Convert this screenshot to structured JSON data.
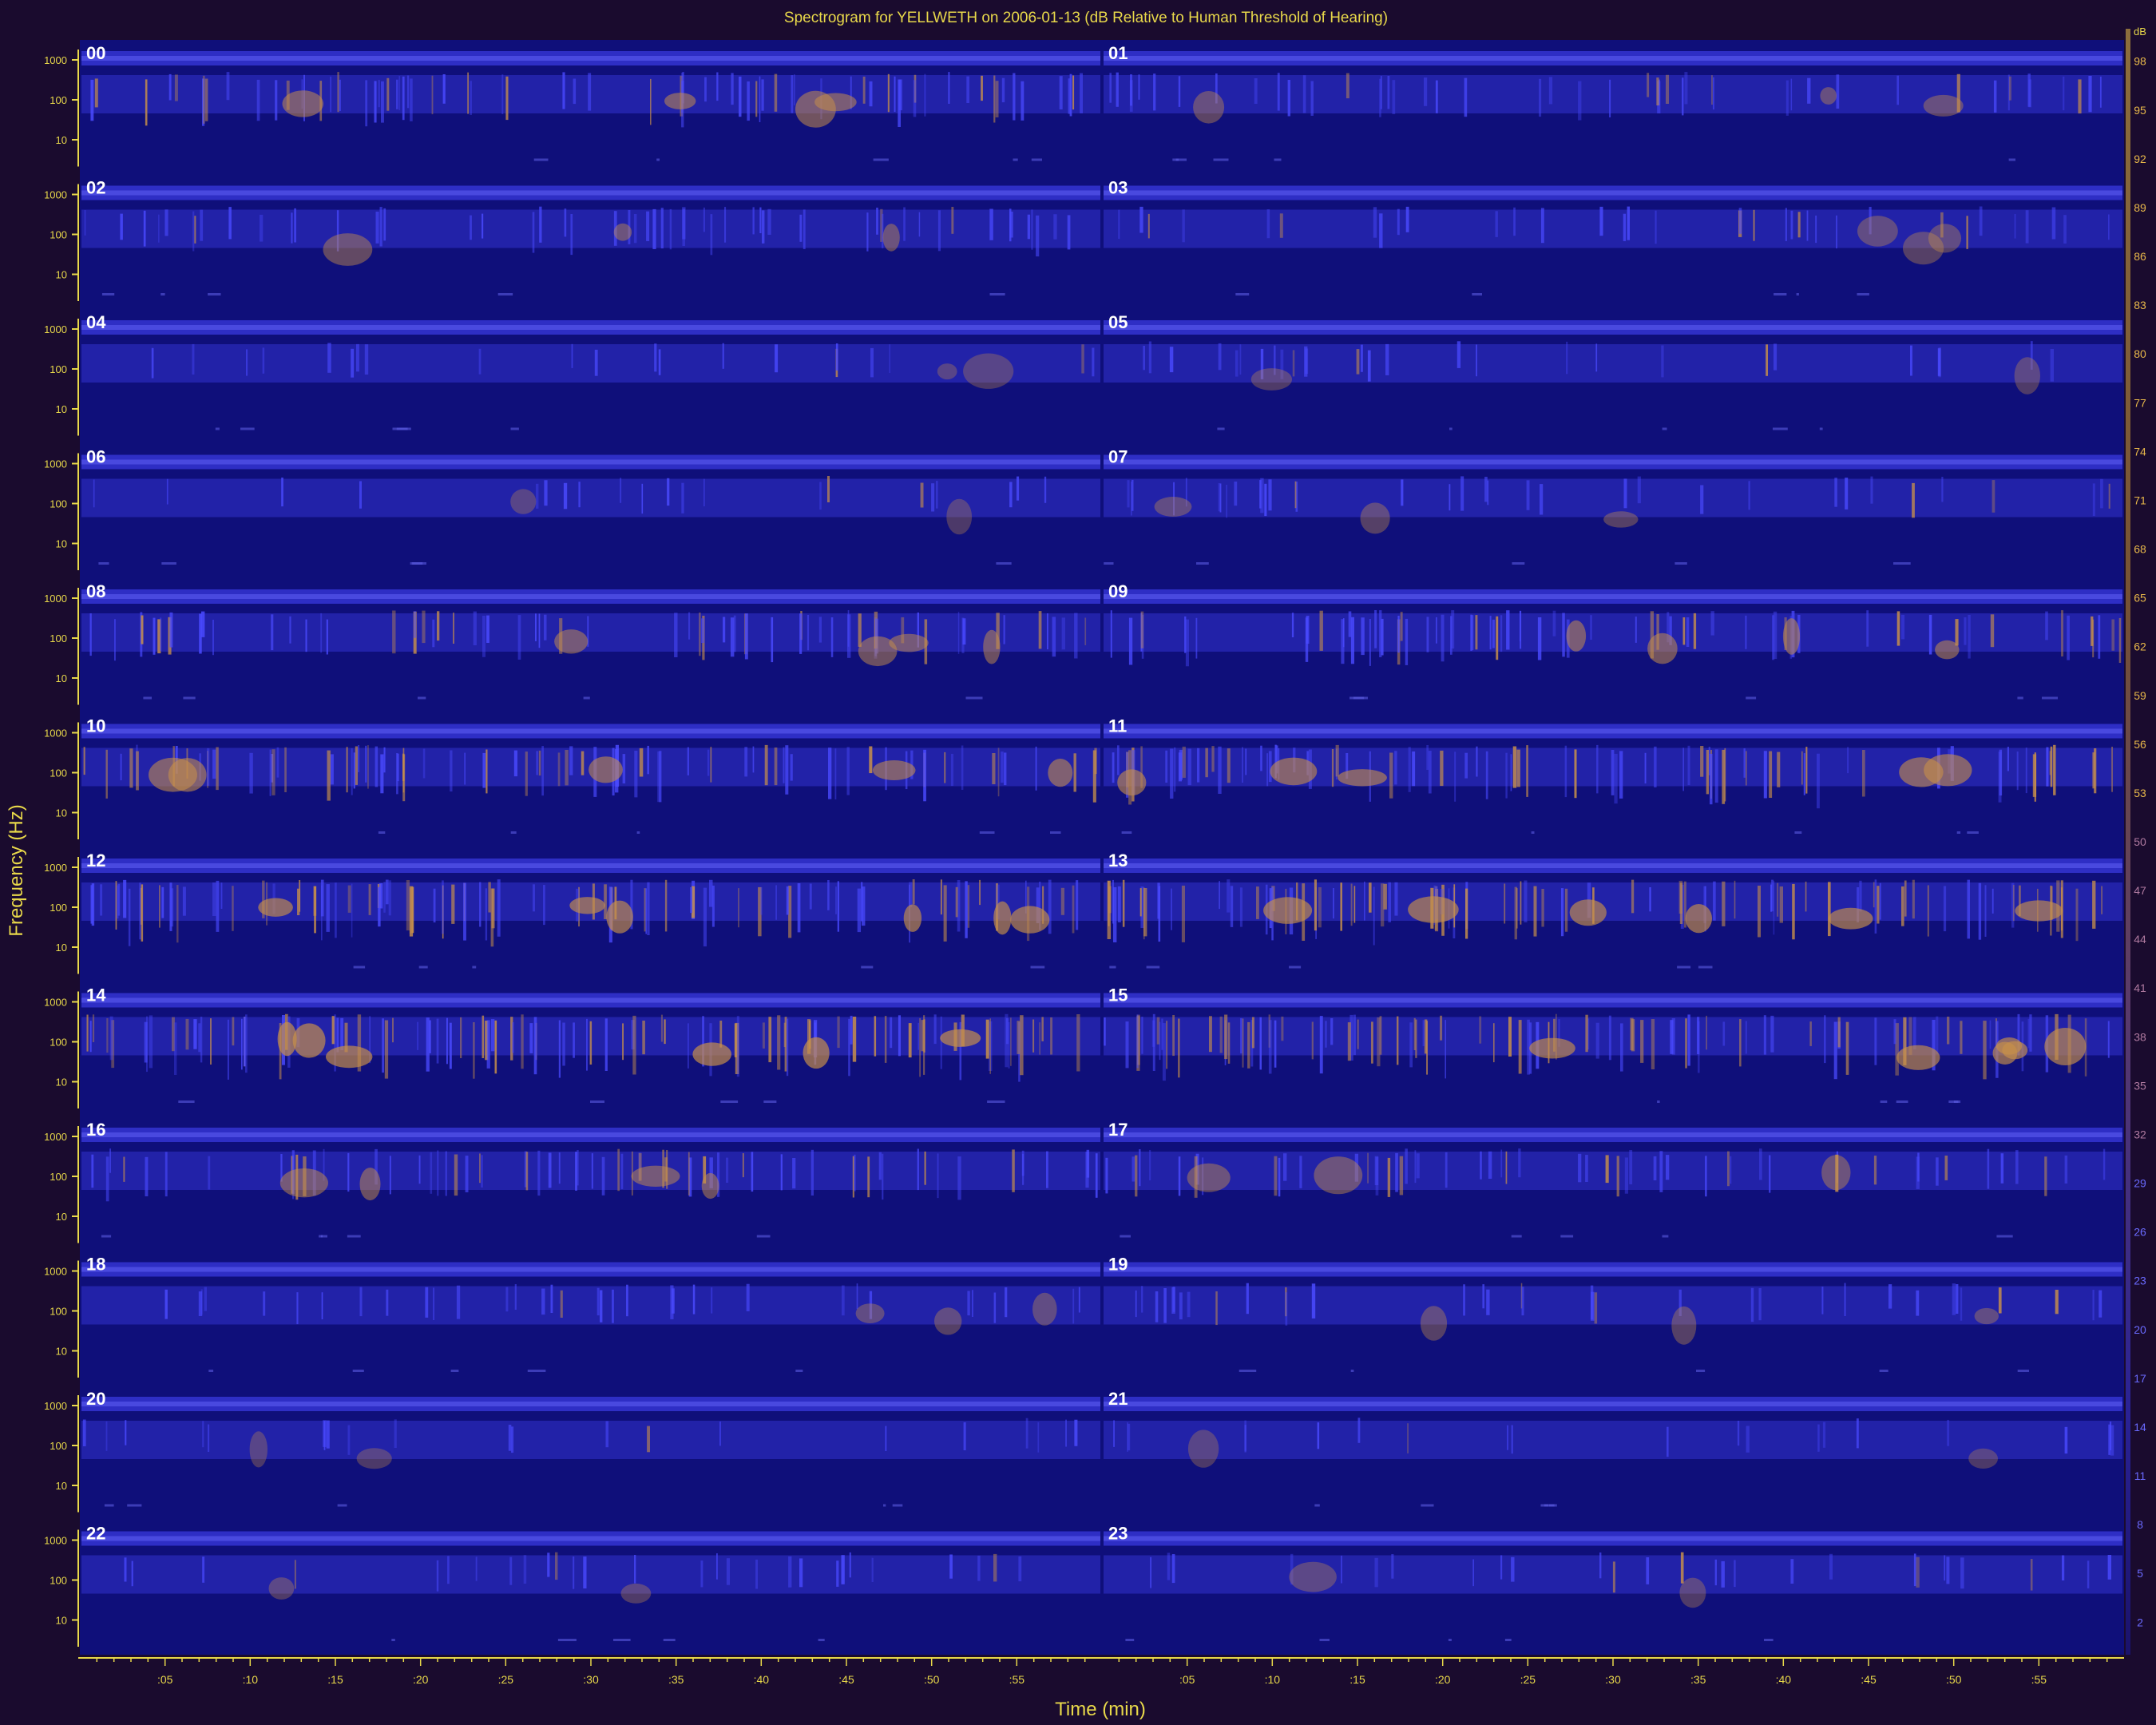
{
  "chart_data": {
    "type": "heatmap",
    "title": "Spectrogram for YELLWETH on 2006-01-13 (dB Relative to Human Threshold of Hearing)",
    "xlabel": "Time (min)",
    "ylabel": "Frequency (Hz)",
    "hour_labels": [
      "00",
      "01",
      "02",
      "03",
      "04",
      "05",
      "06",
      "07",
      "08",
      "09",
      "10",
      "11",
      "12",
      "13",
      "14",
      "15",
      "16",
      "17",
      "18",
      "19",
      "20",
      "21",
      "22",
      "23"
    ],
    "y_tick_labels": [
      "1000",
      "100",
      "10"
    ],
    "x_tick_labels": [
      ":05",
      ":10",
      ":15",
      ":20",
      ":25",
      ":30",
      ":35",
      ":40",
      ":45",
      ":50",
      ":55",
      ":05",
      ":10",
      ":15",
      ":20",
      ":25",
      ":30",
      ":35",
      ":40",
      ":45",
      ":50",
      ":55"
    ],
    "colorbar_unit": "dB",
    "colorbar_ticks": [
      98,
      95,
      92,
      89,
      86,
      83,
      80,
      77,
      74,
      71,
      68,
      65,
      62,
      59,
      56,
      53,
      50,
      47,
      44,
      41,
      38,
      35,
      32,
      29,
      26,
      23,
      20,
      17,
      14,
      11,
      8,
      5,
      2
    ],
    "colorbar_range": [
      0,
      100
    ],
    "activity": [
      0.55,
      0.35,
      0.4,
      0.25,
      0.15,
      0.2,
      0.15,
      0.25,
      0.5,
      0.55,
      0.65,
      0.7,
      0.8,
      0.8,
      0.85,
      0.8,
      0.5,
      0.4,
      0.25,
      0.25,
      0.15,
      0.15,
      0.2,
      0.2
    ],
    "colors": {
      "background": "#1a0b2e",
      "plot": "#0f0f7a",
      "band": "#3a3adf",
      "hot": "#c8904a",
      "axis": "#e8d84a"
    }
  }
}
